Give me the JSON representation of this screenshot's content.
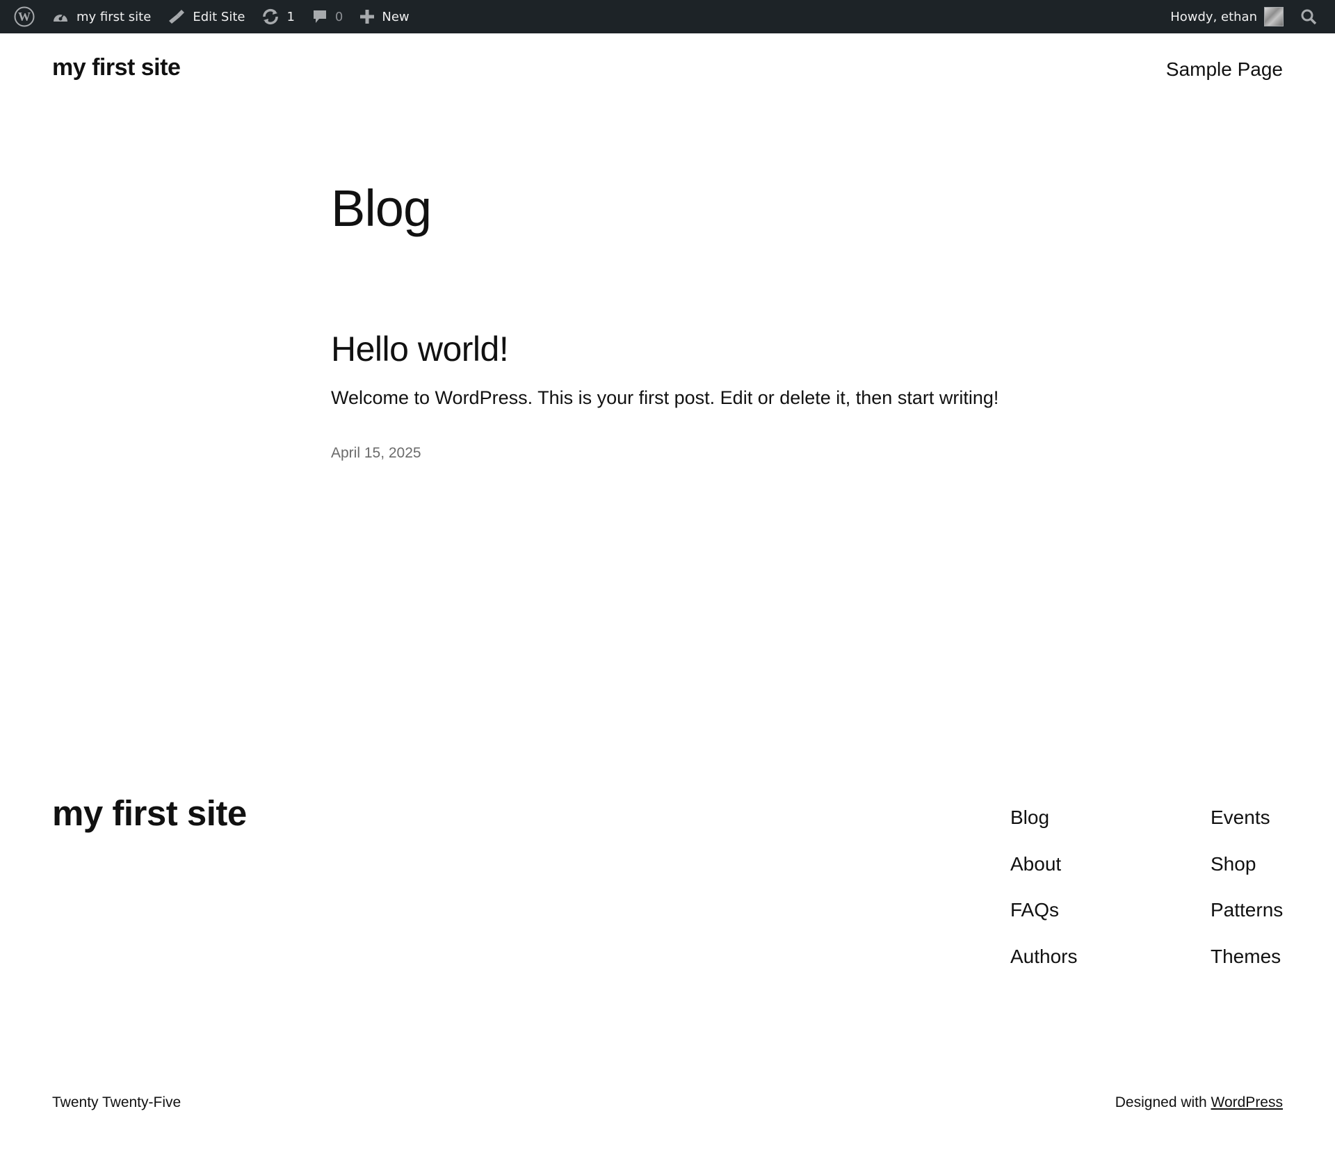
{
  "admin_bar": {
    "site_name": "my first site",
    "edit_site": "Edit Site",
    "updates_count": "1",
    "comments_count": "0",
    "new_label": "New",
    "greeting": "Howdy, ethan"
  },
  "header": {
    "site_title": "my first site",
    "nav": [
      "Sample Page"
    ]
  },
  "main": {
    "page_title": "Blog",
    "posts": [
      {
        "title": "Hello world!",
        "excerpt": "Welcome to WordPress. This is your first post. Edit or delete it, then start writing!",
        "date": "April 15, 2025"
      }
    ]
  },
  "footer": {
    "site_title": "my first site",
    "nav_col_1": [
      "Blog",
      "About",
      "FAQs",
      "Authors"
    ],
    "nav_col_2": [
      "Events",
      "Shop",
      "Patterns",
      "Themes"
    ],
    "credit": "Twenty Twenty-Five",
    "designed_prefix": "Designed with ",
    "designed_link": "WordPress"
  },
  "colors": {
    "admin_bar_bg": "#1d2327",
    "admin_bar_text": "#f0f0f1",
    "muted_text": "#8c8f94",
    "body_text": "#111111",
    "date_text": "#6b6b6b"
  }
}
